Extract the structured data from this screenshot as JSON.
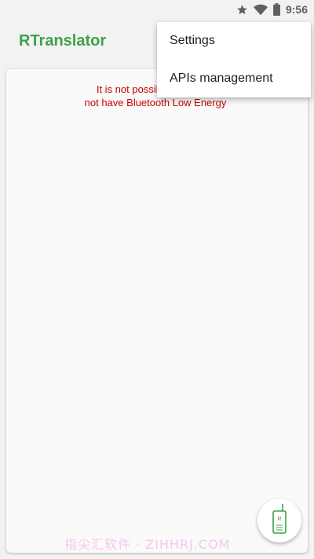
{
  "status_bar": {
    "time": "9:56",
    "icons": [
      "star-icon",
      "wifi-icon",
      "battery-icon"
    ]
  },
  "app_bar": {
    "title": "RTranslator"
  },
  "main": {
    "warning_line1": "It is not possible to search",
    "warning_line2": "not have Bluetooth Low Energy"
  },
  "fab": {
    "icon": "walkie-talkie-icon"
  },
  "overflow_menu": {
    "items": [
      {
        "label": "Settings"
      },
      {
        "label": "APIs management"
      }
    ]
  },
  "watermark": {
    "text": "指尖汇软件 · ZIHHRJ.COM"
  },
  "colors": {
    "accent": "#3da14a",
    "warning": "#c80000",
    "background": "#f2f2f2",
    "card": "#fafafa"
  }
}
